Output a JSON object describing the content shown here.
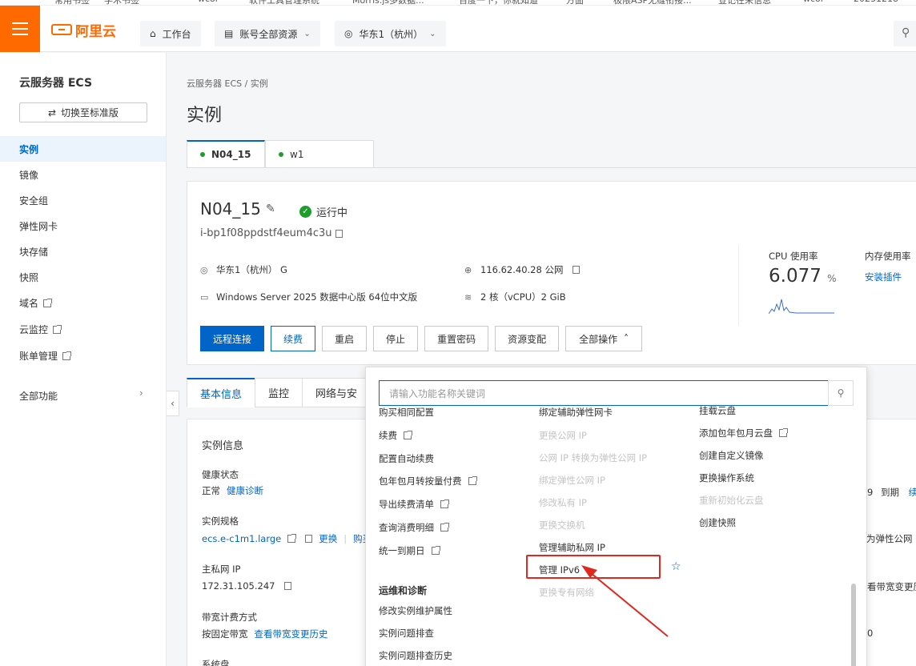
{
  "bookmarks": [
    "常用书签",
    "学术书签",
    "wcol",
    "软件工具管理系统",
    "Morris.js多数据...",
    "百度一下，你就知道",
    "方面",
    "极限ASP无缝衔接...",
    "登记往来信息",
    "wcol",
    "20231218"
  ],
  "topbar": {
    "brand": "阿里云",
    "workbench": "工作台",
    "resources": "账号全部资源",
    "region": "华东1（杭州）"
  },
  "sidebar": {
    "title": "云服务器 ECS",
    "switch_label": "切换至标准版",
    "items": [
      {
        "label": "实例",
        "active": true,
        "ext": false
      },
      {
        "label": "镜像",
        "active": false,
        "ext": false
      },
      {
        "label": "安全组",
        "active": false,
        "ext": false
      },
      {
        "label": "弹性网卡",
        "active": false,
        "ext": false
      },
      {
        "label": "块存储",
        "active": false,
        "ext": false
      },
      {
        "label": "快照",
        "active": false,
        "ext": false
      },
      {
        "label": "域名",
        "active": false,
        "ext": true
      },
      {
        "label": "云监控",
        "active": false,
        "ext": true
      },
      {
        "label": "账单管理",
        "active": false,
        "ext": true
      }
    ],
    "all_features": "全部功能"
  },
  "main": {
    "breadcrumb": "云服务器 ECS  /  实例",
    "title": "实例",
    "instance_tabs": [
      {
        "label": "N04_15",
        "active": true
      },
      {
        "label": "w1",
        "active": false
      }
    ]
  },
  "instance": {
    "name": "N04_15",
    "status": "运行中",
    "id": "i-bp1f08ppdstf4eum4c3u",
    "zone": "华东1（杭州） G",
    "public_ip": "116.62.40.28 公网",
    "os": "Windows Server 2025 数据中心版 64位中文版",
    "spec": "2 核（vCPU）2 GiB",
    "cpu_label": "CPU 使用率",
    "cpu_value": "6.077",
    "cpu_unit": "%",
    "mem_label": "内存使用率",
    "mem_link": "安装插件"
  },
  "actions": {
    "remote": "远程连接",
    "renew": "续费",
    "restart": "重启",
    "stop": "停止",
    "reset_pwd": "重置密码",
    "resource_change": "资源变配",
    "all_ops": "全部操作"
  },
  "sub_tabs": [
    "基本信息",
    "监控",
    "网络与安"
  ],
  "details": {
    "section": "实例信息",
    "health_label": "健康状态",
    "health_value": "正常",
    "health_link": "健康诊断",
    "spec_label": "实例规格",
    "spec_value": "ecs.e-c1m1.large",
    "spec_change": "更换",
    "spec_buy": "购买相",
    "ip_label": "主私网 IP",
    "ip_value": "172.31.105.247",
    "billing_label": "带宽计费方式",
    "billing_value": "按固定带宽",
    "billing_link": "查看带宽变更历史",
    "disk_label": "系统盘",
    "right_expire_prefix": "9",
    "right_expire": "到期",
    "right_renew": "续",
    "right_eip": "为弹性公网 I",
    "right_bw": "看带宽变更历",
    "right_zero": "0"
  },
  "dropdown": {
    "placeholder": "请输入功能名称关键词",
    "col1": [
      {
        "label": "购买相同配置",
        "ext": false,
        "disabled": false
      },
      {
        "label": "续费",
        "ext": true,
        "disabled": false
      },
      {
        "label": "配置自动续费",
        "ext": false,
        "disabled": false
      },
      {
        "label": "包年包月转按量付费",
        "ext": true,
        "disabled": false
      },
      {
        "label": "导出续费清单",
        "ext": true,
        "disabled": false
      },
      {
        "label": "查询消费明细",
        "ext": true,
        "disabled": false
      },
      {
        "label": "统一到期日",
        "ext": true,
        "disabled": false
      }
    ],
    "ops_section": "运维和诊断",
    "ops_items": [
      "修改实例维护属性",
      "实例问题排查",
      "实例问题排查历史"
    ],
    "col2": [
      {
        "label": "绑定辅助弹性网卡",
        "disabled": false
      },
      {
        "label": "更换公网 IP",
        "disabled": true
      },
      {
        "label": "公网 IP 转换为弹性公网 IP",
        "disabled": true
      },
      {
        "label": "绑定弹性公网 IP",
        "disabled": true
      },
      {
        "label": "修改私有 IP",
        "disabled": true
      },
      {
        "label": "更换交换机",
        "disabled": true
      },
      {
        "label": "管理辅助私网 IP",
        "disabled": false
      },
      {
        "label": "管理 IPv6",
        "disabled": false
      },
      {
        "label": "更换专有网络",
        "disabled": true
      }
    ],
    "col3": [
      {
        "label": "挂载云盘",
        "ext": false,
        "disabled": false
      },
      {
        "label": "添加包年包月云盘",
        "ext": true,
        "disabled": false
      },
      {
        "label": "创建自定义镜像",
        "ext": false,
        "disabled": false
      },
      {
        "label": "更换操作系统",
        "ext": false,
        "disabled": false
      },
      {
        "label": "重新初始化云盘",
        "ext": false,
        "disabled": true
      },
      {
        "label": "创建快照",
        "ext": false,
        "disabled": false
      }
    ]
  },
  "colors": {
    "brand": "#ff6a00",
    "primary": "#0064c8",
    "success": "#1c9d2c",
    "annotation": "#e0281e"
  }
}
